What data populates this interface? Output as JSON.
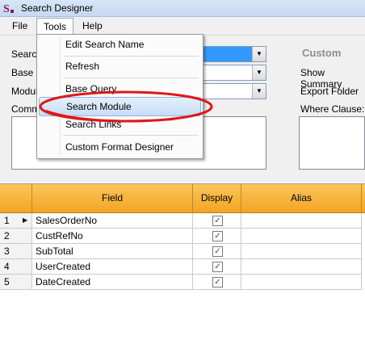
{
  "window": {
    "title": "Search Designer"
  },
  "menu": {
    "file": "File",
    "tools": "Tools",
    "help": "Help"
  },
  "tools_menu": {
    "items": [
      "Edit Search Name",
      "Refresh",
      "Base Query",
      "Search Module",
      "Search Links",
      "Custom Format Designer"
    ]
  },
  "form": {
    "labels": [
      "Search",
      "Base Q",
      "Modul",
      "Comm"
    ],
    "custom_heading": "Custom",
    "show_summary": "Show Summary",
    "export_folder": "Export Folder",
    "where_clause": "Where Clause:"
  },
  "grid": {
    "columns": [
      "Field",
      "Display",
      "Alias"
    ],
    "rows": [
      {
        "num": "1",
        "field": "SalesOrderNo",
        "display": true
      },
      {
        "num": "2",
        "field": "CustRefNo",
        "display": true
      },
      {
        "num": "3",
        "field": "SubTotal",
        "display": true
      },
      {
        "num": "4",
        "field": "UserCreated",
        "display": true
      },
      {
        "num": "5",
        "field": "DateCreated",
        "display": true
      }
    ]
  },
  "colors": {
    "grid_header": "#f2a524",
    "menu_highlight": "#c7ddf4",
    "annotation": "#e0161a"
  }
}
